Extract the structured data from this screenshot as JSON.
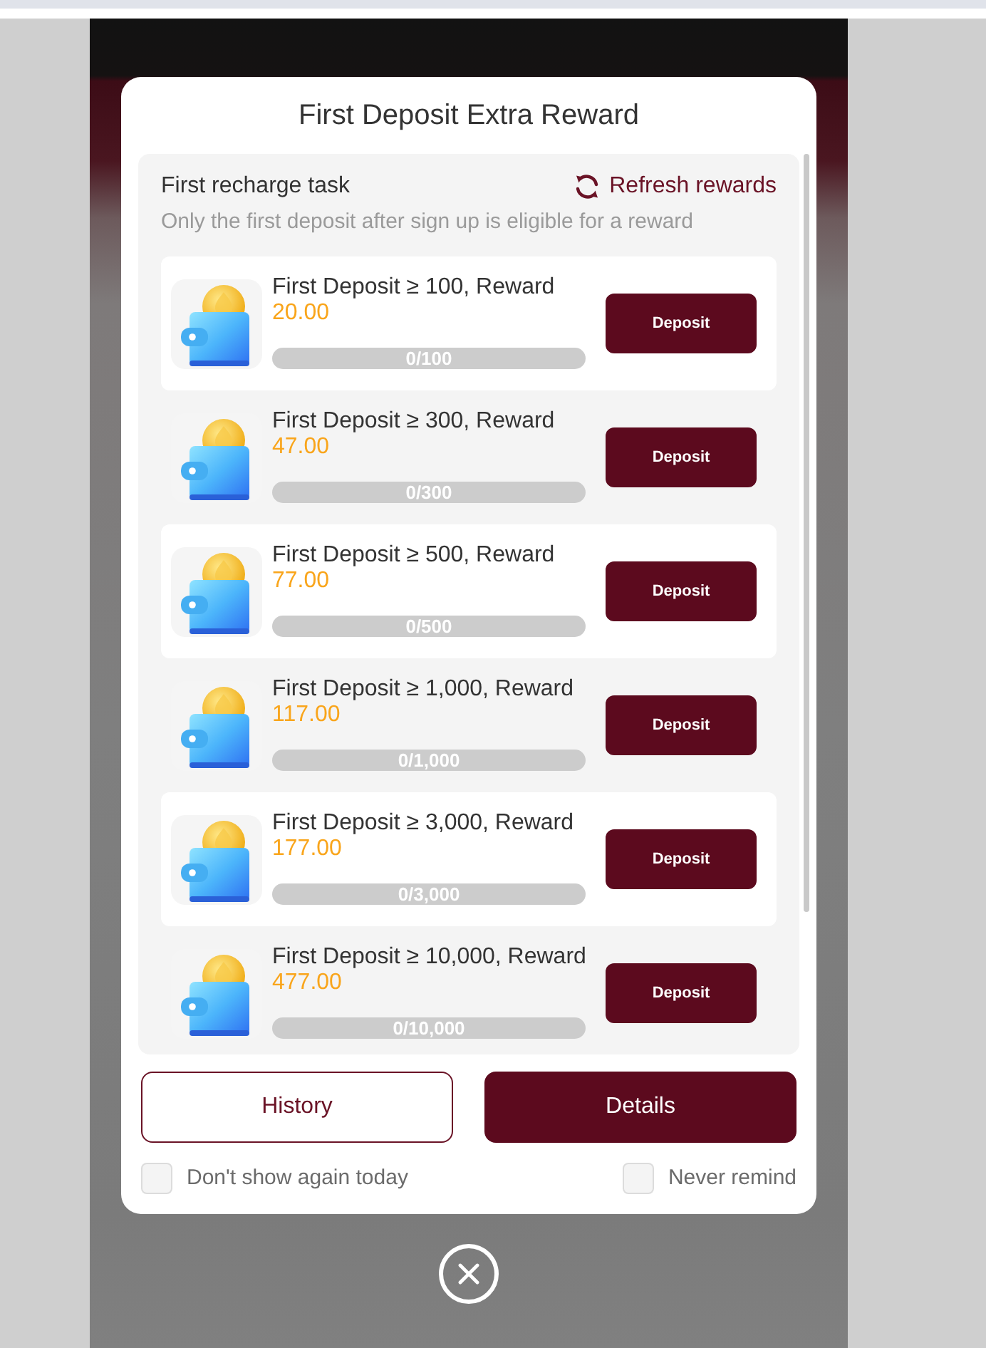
{
  "dialog": {
    "title": "First Deposit Extra Reward"
  },
  "task": {
    "title": "First recharge task",
    "refresh": "Refresh rewards",
    "note": "Only the first deposit after sign up is eligible for a reward"
  },
  "rewards": [
    {
      "title": "First Deposit ≥ 100, Reward",
      "amount": "20.00",
      "progress": "0/100",
      "level": 0,
      "button": "Deposit"
    },
    {
      "title": "First Deposit ≥ 300, Reward",
      "amount": "47.00",
      "progress": "0/300",
      "level": 0,
      "button": "Deposit"
    },
    {
      "title": "First Deposit ≥ 500, Reward",
      "amount": "77.00",
      "progress": "0/500",
      "level": 0,
      "button": "Deposit"
    },
    {
      "title": "First Deposit ≥ 1,000, Reward",
      "amount": "117.00",
      "progress": "0/1,000",
      "level": 0,
      "button": "Deposit"
    },
    {
      "title": "First Deposit ≥ 3,000, Reward",
      "amount": "177.00",
      "progress": "0/3,000",
      "level": 0,
      "button": "Deposit"
    },
    {
      "title": "First Deposit ≥ 10,000, Reward",
      "amount": "477.00",
      "progress": "0/10,000",
      "level": 0,
      "button": "Deposit"
    }
  ],
  "buttons": [
    {
      "label": "History",
      "kind": "outline"
    },
    {
      "label": "Details",
      "kind": "filled"
    }
  ],
  "options": [
    {
      "label": "Don't show again today",
      "checked": false
    },
    {
      "label": "Never remind",
      "checked": false
    }
  ]
}
